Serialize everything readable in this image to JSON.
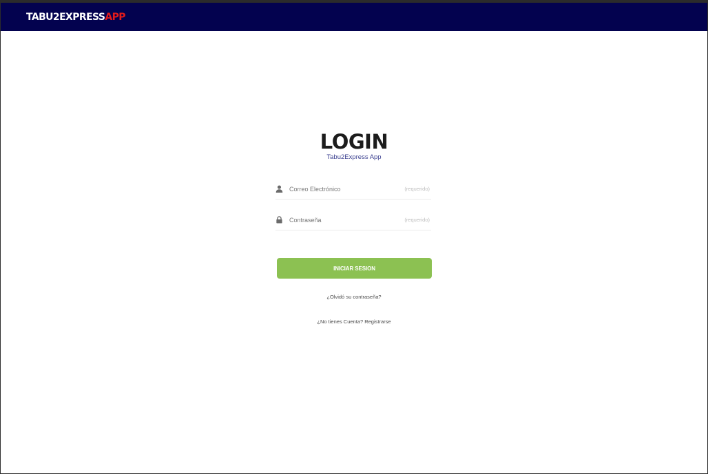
{
  "navbar": {
    "brand_main": "TABU2EXPRESS",
    "brand_accent": "APP",
    "background_color": "#03024f",
    "accent_color": "#e31b1b"
  },
  "login": {
    "title": "LOGIN",
    "subtitle": "Tabu2Express App",
    "email": {
      "icon": "user-icon",
      "placeholder": "Correo Electrónico",
      "value": "",
      "hint": "(requerido)"
    },
    "password": {
      "icon": "lock-icon",
      "placeholder": "Contraseña",
      "value": "",
      "hint": "(requerido)"
    },
    "submit_label": "INICIAR SESION",
    "submit_color": "#8cc152",
    "forgot_link": "¿Olvidó su contraseña?",
    "register_link": "¿No tienes Cuenta? Registrarse"
  }
}
